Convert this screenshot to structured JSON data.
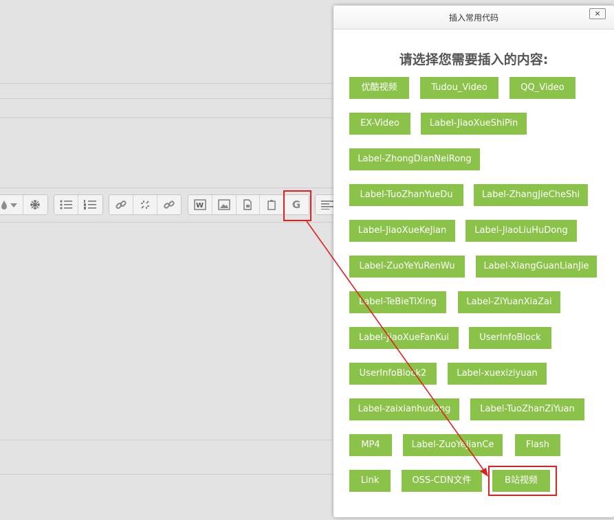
{
  "dialog": {
    "title": "插入常用代码",
    "close_label": "×",
    "heading": "请选择您需要插入的内容:",
    "buttons": [
      "优酷视频",
      "Tudou_Video",
      "QQ_Video",
      "EX-Video",
      "Label-JiaoXueShiPin",
      "Label-ZhongDianNeiRong",
      "Label-TuoZhanYueDu",
      "Label-ZhangJieCheShi",
      "Label-JiaoXueKeJian",
      "Label-JiaoLiuHuDong",
      "Label-ZuoYeYuRenWu",
      "Label-XiangGuanLianJie",
      "Label-TeBieTiXing",
      "Label-ZiYuanXiaZai",
      "Label-JiaoXueFanKui",
      "UserInfoBlock",
      "UserInfoBlock2",
      "Label-xuexiziyuan",
      "Label-zaixianhudong",
      "Label-TuoZhanZiYuan",
      "MP4",
      "Label-ZuoYeJianCe",
      "Flash",
      "Link",
      "OSS-CDN文件",
      "B站视频"
    ],
    "button_color": "#8bc34a"
  },
  "toolbar": {
    "g_button_label": "G",
    "icons": [
      "color-dropdown-icon",
      "snowflake-icon",
      "bullet-list-icon",
      "numbered-list-icon",
      "link-icon",
      "unlink-icon",
      "anchor-link-icon",
      "word-paste-icon",
      "image-icon",
      "media-icon",
      "clipboard-icon",
      "g-insert-code-icon",
      "align-left-icon"
    ]
  },
  "annotation": {
    "color": "#e01f1f"
  }
}
